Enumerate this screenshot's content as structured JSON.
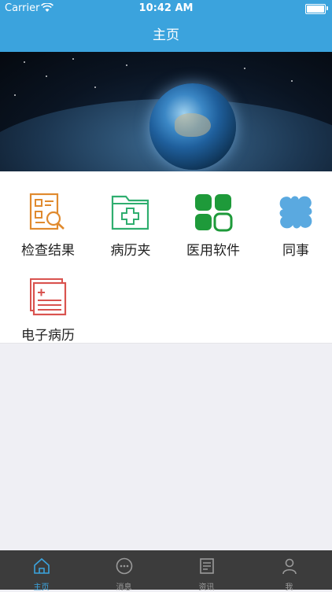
{
  "status_bar": {
    "carrier": "Carrier",
    "time": "10:42 AM"
  },
  "nav": {
    "title": "主页"
  },
  "banner": {
    "page_count": 4,
    "active_page": 2
  },
  "menu": [
    {
      "label": "检查结果",
      "icon": "exam-report-icon",
      "color": "#e08a2e"
    },
    {
      "label": "病历夹",
      "icon": "medical-folder-icon",
      "color": "#2fae6f"
    },
    {
      "label": "医用软件",
      "icon": "apps-grid-icon",
      "color": "#1e9a3a"
    },
    {
      "label": "同事",
      "icon": "clover-icon",
      "color": "#5aa9e0"
    },
    {
      "label": "电子病历",
      "icon": "electronic-record-icon",
      "color": "#d9534f"
    }
  ],
  "tabs": [
    {
      "label": "主页",
      "icon": "home-icon",
      "active": true
    },
    {
      "label": "消息",
      "icon": "message-icon",
      "active": false
    },
    {
      "label": "资讯",
      "icon": "news-icon",
      "active": false
    },
    {
      "label": "我",
      "icon": "profile-icon",
      "active": false
    }
  ],
  "colors": {
    "accent": "#3ba3dd",
    "tabbar": "#3c3c3c",
    "background": "#efeff4"
  }
}
